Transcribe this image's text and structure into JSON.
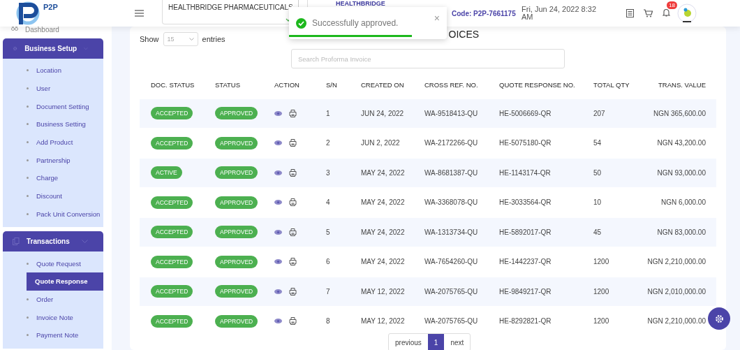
{
  "header": {
    "company_select": {
      "value": "HEALTHBRIDGE PHARMACEUTICALS"
    },
    "logo_text": "P2P",
    "business_name": "HEALTHBRIDGE",
    "code": "Code: P2P-7661175",
    "datetime": "Fri, Jun 24, 2022 8:32 AM",
    "notification_count": "18"
  },
  "toast": {
    "message": "Successfully approved.",
    "close": "×",
    "level": 0.78
  },
  "sidebar": {
    "items": [
      {
        "kind": "link",
        "label": "Dashboard"
      },
      {
        "kind": "group",
        "label": "Business Setup",
        "expanded": true,
        "children": [
          {
            "label": "Location",
            "selected": false
          },
          {
            "label": "User",
            "selected": false
          },
          {
            "label": "Document Setting",
            "selected": false
          },
          {
            "label": "Business Setting",
            "selected": false
          },
          {
            "label": "Add Product",
            "selected": false
          },
          {
            "label": "Partnership",
            "selected": false
          },
          {
            "label": "Charge",
            "selected": false
          },
          {
            "label": "Discount",
            "selected": false
          },
          {
            "label": "Pack Unit Conversion",
            "selected": false
          }
        ]
      },
      {
        "kind": "group",
        "label": "Transactions",
        "expanded": true,
        "children": [
          {
            "label": "Quote Request",
            "selected": false
          },
          {
            "label": "Quote Response",
            "selected": true
          },
          {
            "label": "Order",
            "selected": false
          },
          {
            "label": "Invoice Note",
            "selected": false
          },
          {
            "label": "Payment Note",
            "selected": false
          }
        ]
      }
    ]
  },
  "page": {
    "title": "OICES",
    "show_label": "Show",
    "entries_value": "15",
    "entries_label": "entries",
    "search": {
      "placeholder": "Search Proforma Invoice"
    }
  },
  "table": {
    "columns": [
      "DOC. STATUS",
      "STATUS",
      "ACTION",
      "S/N",
      "CREATED ON",
      "CROSS REF. NO.",
      "QUOTE RESPONSE NO.",
      "TOTAL QTY",
      "TRANS. VALUE"
    ],
    "rows": [
      {
        "doc_status": "ACCEPTED",
        "status": "APPROVED",
        "sn": "1",
        "created_on": "JUN 24, 2022",
        "cross_ref": "WA-9518413-QU",
        "quote_response": "HE-5006669-QR",
        "total_qty": "207",
        "trans_value": "NGN 365,600.00"
      },
      {
        "doc_status": "ACCEPTED",
        "status": "APPROVED",
        "sn": "2",
        "created_on": "JUN 2, 2022",
        "cross_ref": "WA-2172266-QU",
        "quote_response": "HE-5075180-QR",
        "total_qty": "54",
        "trans_value": "NGN 43,200.00"
      },
      {
        "doc_status": "ACTIVE",
        "status": "APPROVED",
        "sn": "3",
        "created_on": "MAY 24, 2022",
        "cross_ref": "WA-8681387-QU",
        "quote_response": "HE-1143174-QR",
        "total_qty": "50",
        "trans_value": "NGN 93,000.00"
      },
      {
        "doc_status": "ACCEPTED",
        "status": "APPROVED",
        "sn": "4",
        "created_on": "MAY 24, 2022",
        "cross_ref": "WA-3368078-QU",
        "quote_response": "HE-3033564-QR",
        "total_qty": "10",
        "trans_value": "NGN 6,000.00"
      },
      {
        "doc_status": "ACCEPTED",
        "status": "APPROVED",
        "sn": "5",
        "created_on": "MAY 24, 2022",
        "cross_ref": "WA-1313734-QU",
        "quote_response": "HE-5892017-QR",
        "total_qty": "45",
        "trans_value": "NGN 83,000.00"
      },
      {
        "doc_status": "ACCEPTED",
        "status": "APPROVED",
        "sn": "6",
        "created_on": "MAY 24, 2022",
        "cross_ref": "WA-7654260-QU",
        "quote_response": "HE-1442237-QR",
        "total_qty": "1200",
        "trans_value": "NGN 2,210,000.00"
      },
      {
        "doc_status": "ACCEPTED",
        "status": "APPROVED",
        "sn": "7",
        "created_on": "MAY 12, 2022",
        "cross_ref": "WA-2075765-QU",
        "quote_response": "HE-9849217-QR",
        "total_qty": "1200",
        "trans_value": "NGN 2,010,000.00"
      },
      {
        "doc_status": "ACCEPTED",
        "status": "APPROVED",
        "sn": "8",
        "created_on": "MAY 12, 2022",
        "cross_ref": "WA-2075765-QU",
        "quote_response": "HE-8292821-QR",
        "total_qty": "1200",
        "trans_value": "NGN 2,210,000.00"
      }
    ]
  },
  "pagination": [
    {
      "label": "previous",
      "selected": false
    },
    {
      "label": "1",
      "selected": true
    },
    {
      "label": "next",
      "selected": false
    }
  ]
}
